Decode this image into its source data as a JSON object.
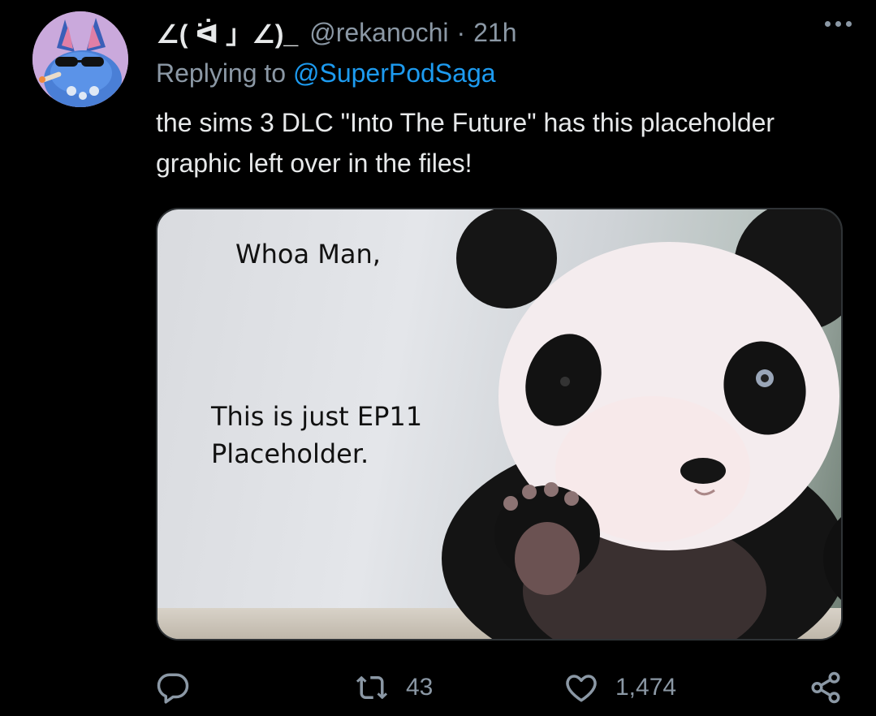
{
  "tweet": {
    "display_name": "∠( ᐛ 」∠)_",
    "handle": "@rekanochi",
    "separator": "·",
    "time": "21h",
    "replying_prefix": "Replying to",
    "replying_handle": "@SuperPodSaga",
    "text": "the sims 3 DLC \"Into The Future\" has this placeholder graphic left over in the files!"
  },
  "media": {
    "caption_top": "Whoa Man,",
    "caption_bottom_1": "This is just EP11",
    "caption_bottom_2": "Placeholder."
  },
  "actions": {
    "reply_icon": "reply-icon",
    "retweet_icon": "retweet-icon",
    "retweet_count": "43",
    "like_icon": "heart-icon",
    "like_count": "1,474",
    "share_icon": "share-icon"
  },
  "colors": {
    "background": "#000000",
    "text": "#e7e9ea",
    "secondary": "#8b98a5",
    "link": "#1d9bf0"
  }
}
